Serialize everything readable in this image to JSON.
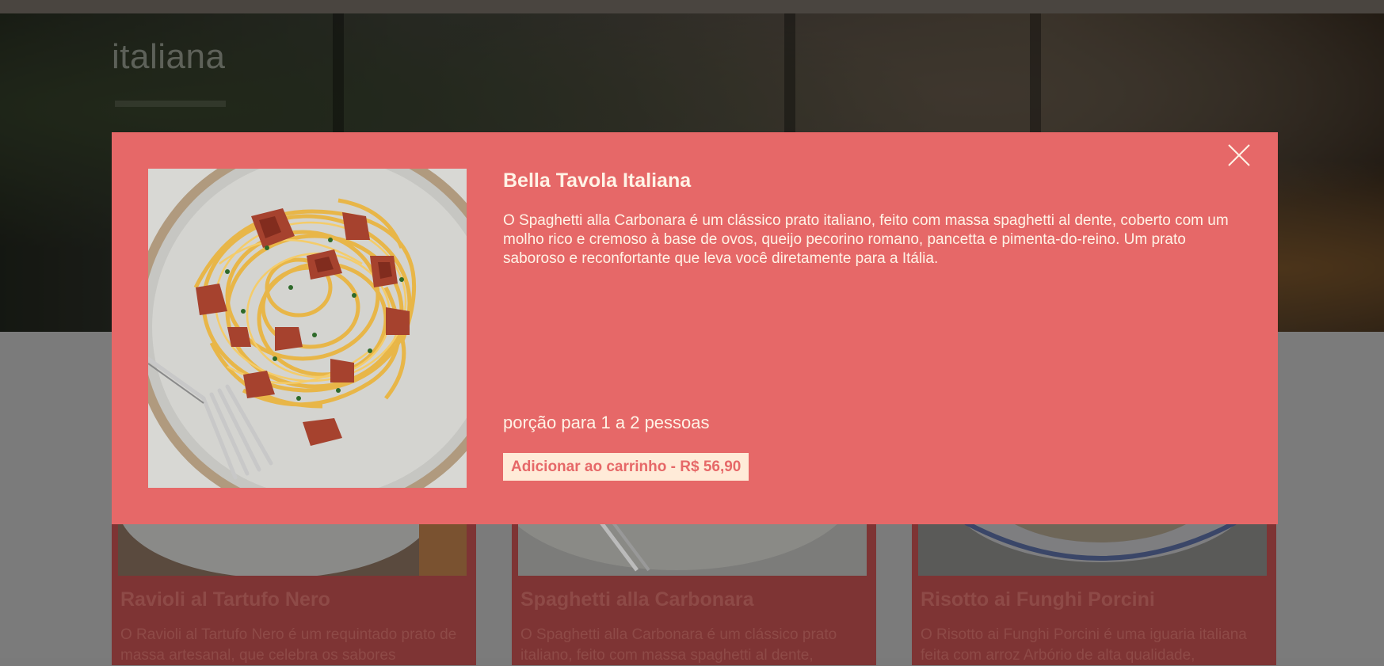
{
  "header": {
    "brand": "italiana"
  },
  "modal": {
    "title": "Bella Tavola Italiana",
    "description": "O Spaghetti alla Carbonara é um clássico prato italiano, feito com massa spaghetti al dente, coberto com um molho rico e cremoso à base de ovos, queijo pecorino romano, pancetta e pimenta-do-reino. Um prato saboroso e reconfortante que leva você diretamente para a Itália.",
    "portion": "porção para 1 a 2 pessoas",
    "add_button": "Adicionar ao carrinho - R$ 56,90",
    "close_icon": "close-icon",
    "image_icon": "spaghetti-carbonara-image"
  },
  "cards": [
    {
      "title": "Ravioli al Tartufo Nero",
      "description": "O Ravioli al Tartufo Nero é um requintado prato de massa artesanal, que celebra os sabores"
    },
    {
      "title": "Spaghetti alla Carbonara",
      "description": "O Spaghetti alla Carbonara é um clássico prato italiano, feito com massa spaghetti al dente,"
    },
    {
      "title": "Risotto ai Funghi Porcini",
      "description": "O Risotto ai Funghi Porcini é uma iguaria italiana feita com arroz Arbório de alta qualidade,"
    }
  ],
  "colors": {
    "modal_bg": "#e66868",
    "button_bg": "#ffebd8",
    "text_light": "#fff3e6"
  }
}
